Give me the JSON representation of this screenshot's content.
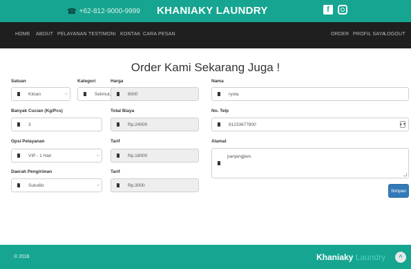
{
  "header": {
    "phone": "+62-812-9000-9999",
    "brand": "KHANIAKY LAUNDRY",
    "icons": [
      "phone-icon",
      "facebook-icon",
      "instagram-icon"
    ]
  },
  "nav": {
    "left": [
      "HOME",
      "ABOUT",
      "PELAYANAN",
      "TESTIMONI",
      "KONTAK",
      "CARA PESAN"
    ],
    "right": [
      "ORDER",
      "PROFIL SAYA",
      "LOGOUT"
    ]
  },
  "heading": "Order Kami Sekarang Juga !",
  "form": {
    "satuan": {
      "label": "Satuan",
      "value": "Kiloan"
    },
    "kategori": {
      "label": "Kategori",
      "value": "Selimut,Sprei,Jas"
    },
    "harga": {
      "label": "Harga",
      "value": "8000"
    },
    "nama": {
      "label": "Nama",
      "value": "ryota"
    },
    "banyak": {
      "label": "Banyak Cucian (Kg/Pcs)",
      "value": "3"
    },
    "total": {
      "label": "Total Biaya",
      "value": "Rp.24000"
    },
    "telp": {
      "label": "No. Telp",
      "value": "81233677800"
    },
    "opsi": {
      "label": "Opsi Pelayanan",
      "value": "VIP - 1 Hari"
    },
    "tarif1": {
      "label": "Tarif",
      "value": "Rp.18000"
    },
    "alamat": {
      "label": "Alamat",
      "value": "panjangjiwo"
    },
    "daerah": {
      "label": "Daerah Pengiriman",
      "value": "Sukolilo"
    },
    "tarif2": {
      "label": "Tarif",
      "value": "Rp.3000"
    },
    "submit": "Simpan"
  },
  "footer": {
    "copyright": "© 2018",
    "brand_bold": "Khaniaky",
    "brand_light": "Laundry",
    "up_icon": "chevron-up-icon"
  },
  "colors": {
    "teal": "#16a590",
    "nav": "#1f1f1f",
    "primary": "#337ab7"
  }
}
